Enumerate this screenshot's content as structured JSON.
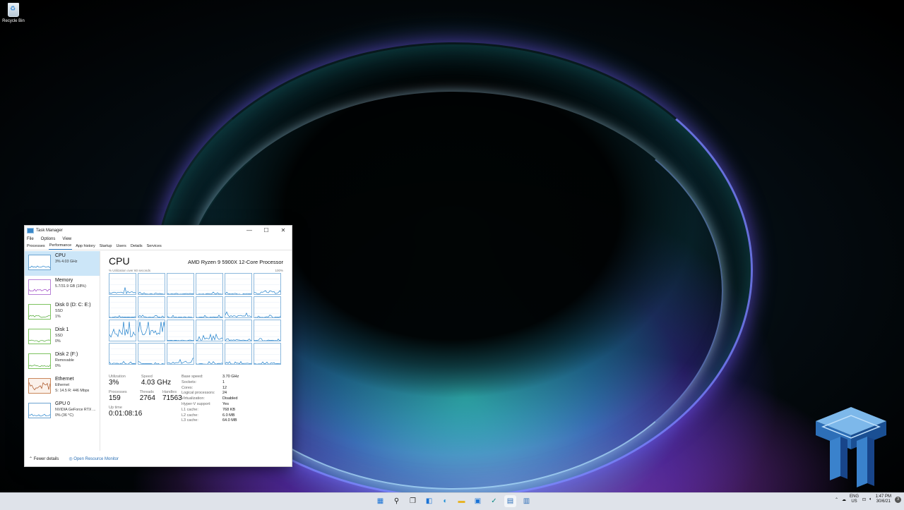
{
  "desktop": {
    "icons": [
      {
        "label": "Recycle Bin",
        "icon": "recycle-bin-icon"
      }
    ]
  },
  "task_manager": {
    "title": "Task Manager",
    "window_controls": [
      "—",
      "☐",
      "✕"
    ],
    "menu": [
      "File",
      "Options",
      "View"
    ],
    "tabs": [
      "Processes",
      "Performance",
      "App history",
      "Startup",
      "Users",
      "Details",
      "Services"
    ],
    "active_tab": "Performance",
    "resources": [
      {
        "name": "CPU",
        "sub1": "3% 4.03 GHz",
        "sub2": "",
        "sub3": "",
        "color": "#1e7fcb"
      },
      {
        "name": "Memory",
        "sub1": "5.7/31.9 GB (18%)",
        "sub2": "",
        "sub3": "",
        "color": "#9b3fc3"
      },
      {
        "name": "Disk 0 (D: C: E:)",
        "sub1": "SSD",
        "sub2": "1%",
        "sub3": "",
        "color": "#4da730"
      },
      {
        "name": "Disk 1",
        "sub1": "SSD",
        "sub2": "0%",
        "sub3": "",
        "color": "#4da730"
      },
      {
        "name": "Disk 2 (F:)",
        "sub1": "Removable",
        "sub2": "0%",
        "sub3": "",
        "color": "#4da730"
      },
      {
        "name": "Ethernet",
        "sub1": "Ethernet",
        "sub2": "S: 14.5  R: 446 Mbps",
        "sub3": "",
        "color": "#a74f1e"
      },
      {
        "name": "GPU 0",
        "sub1": "NVIDIA GeForce RTX ...",
        "sub2": "0% (36 °C)",
        "sub3": "",
        "color": "#1e7fcb"
      }
    ],
    "cpu": {
      "title": "CPU",
      "model": "AMD Ryzen 9 5900X 12-Core Processor",
      "graph_label": "% Utilization over 60 seconds",
      "graph_max": "100%",
      "logical_processors_graphs": 24,
      "stats": {
        "utilization_label": "Utilization",
        "utilization": "3%",
        "speed_label": "Speed",
        "speed": "4.03 GHz",
        "processes_label": "Processes",
        "processes": "159",
        "threads_label": "Threads",
        "threads": "2764",
        "handles_label": "Handles",
        "handles": "71563",
        "uptime_label": "Up time",
        "uptime": "0:01:08:16"
      },
      "details": [
        {
          "k": "Base speed:",
          "v": "3.70 GHz"
        },
        {
          "k": "Sockets:",
          "v": "1"
        },
        {
          "k": "Cores:",
          "v": "12"
        },
        {
          "k": "Logical processors:",
          "v": "24"
        },
        {
          "k": "Virtualization:",
          "v": "Disabled"
        },
        {
          "k": "Hyper-V support:",
          "v": "Yes"
        },
        {
          "k": "L1 cache:",
          "v": "768 KB"
        },
        {
          "k": "L2 cache:",
          "v": "6.0 MB"
        },
        {
          "k": "L3 cache:",
          "v": "64.0 MB"
        }
      ]
    },
    "footer": {
      "fewer_details": "Fewer details",
      "open_resource_monitor": "Open Resource Monitor"
    }
  },
  "taskbar": {
    "apps": [
      "windows-start-icon",
      "search-icon",
      "task-view-icon",
      "widgets-icon",
      "edge-icon",
      "file-explorer-icon",
      "store-icon",
      "steam-icon",
      "task-manager-icon",
      "app-icon"
    ],
    "tray": {
      "lang_top": "ENG",
      "lang_bottom": "US",
      "time": "1:47 PM",
      "date": "30/6/21",
      "notifications": "3"
    }
  }
}
